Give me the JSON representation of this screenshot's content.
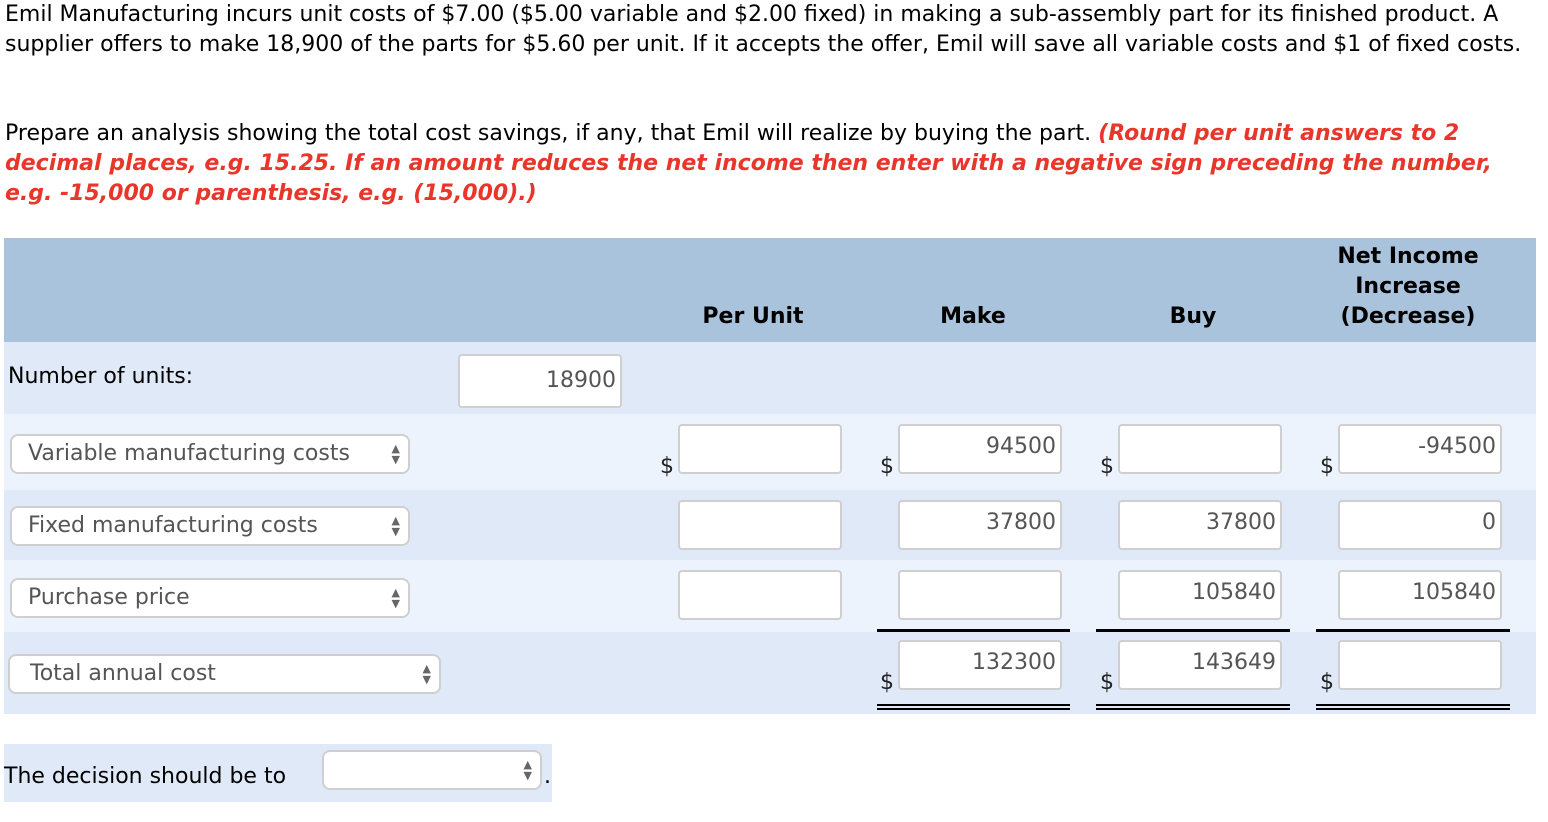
{
  "problem": {
    "text": "Emil Manufacturing incurs unit costs of $7.00 ($5.00 variable and $2.00 fixed) in making a sub-assembly part for its finished product. A supplier offers to make 18,900 of the parts for $5.60 per unit. If it accepts the offer, Emil will save all variable costs and $1 of fixed costs.",
    "instruction": "Prepare an analysis showing the total cost savings, if any, that Emil will realize by buying the part. ",
    "note": "(Round per unit answers to 2 decimal places, e.g. 15.25. If an amount reduces the net income then enter with a negative sign preceding the number, e.g. -15,000 or parenthesis, e.g. (15,000).)"
  },
  "table": {
    "headers": {
      "per_unit": "Per Unit",
      "make": "Make",
      "buy": "Buy",
      "net_line1": "Net Income",
      "net_line2": "Increase",
      "net_line3": "(Decrease)"
    },
    "units_label": "Number of units:",
    "units_value": "18900",
    "currency_symbol": "$",
    "rows": [
      {
        "select": "Variable manufacturing costs",
        "per_unit": "",
        "make": "94500",
        "buy": "",
        "net": "-94500"
      },
      {
        "select": "Fixed manufacturing costs",
        "per_unit": "",
        "make": "37800",
        "buy": "37800",
        "net": "0"
      },
      {
        "select": "Purchase price",
        "per_unit": "",
        "make": "",
        "buy": "105840",
        "net": "105840"
      }
    ],
    "total": {
      "select": "Total annual cost",
      "make": "132300",
      "buy": "143649",
      "net": ""
    }
  },
  "decision": {
    "label": "The decision should be to",
    "value": "",
    "suffix": "."
  },
  "colors": {
    "header_bg": "#a9c3dc",
    "row_dark": "#e0e9f7",
    "row_light": "#edf3fd",
    "note_red": "#e8362a"
  }
}
